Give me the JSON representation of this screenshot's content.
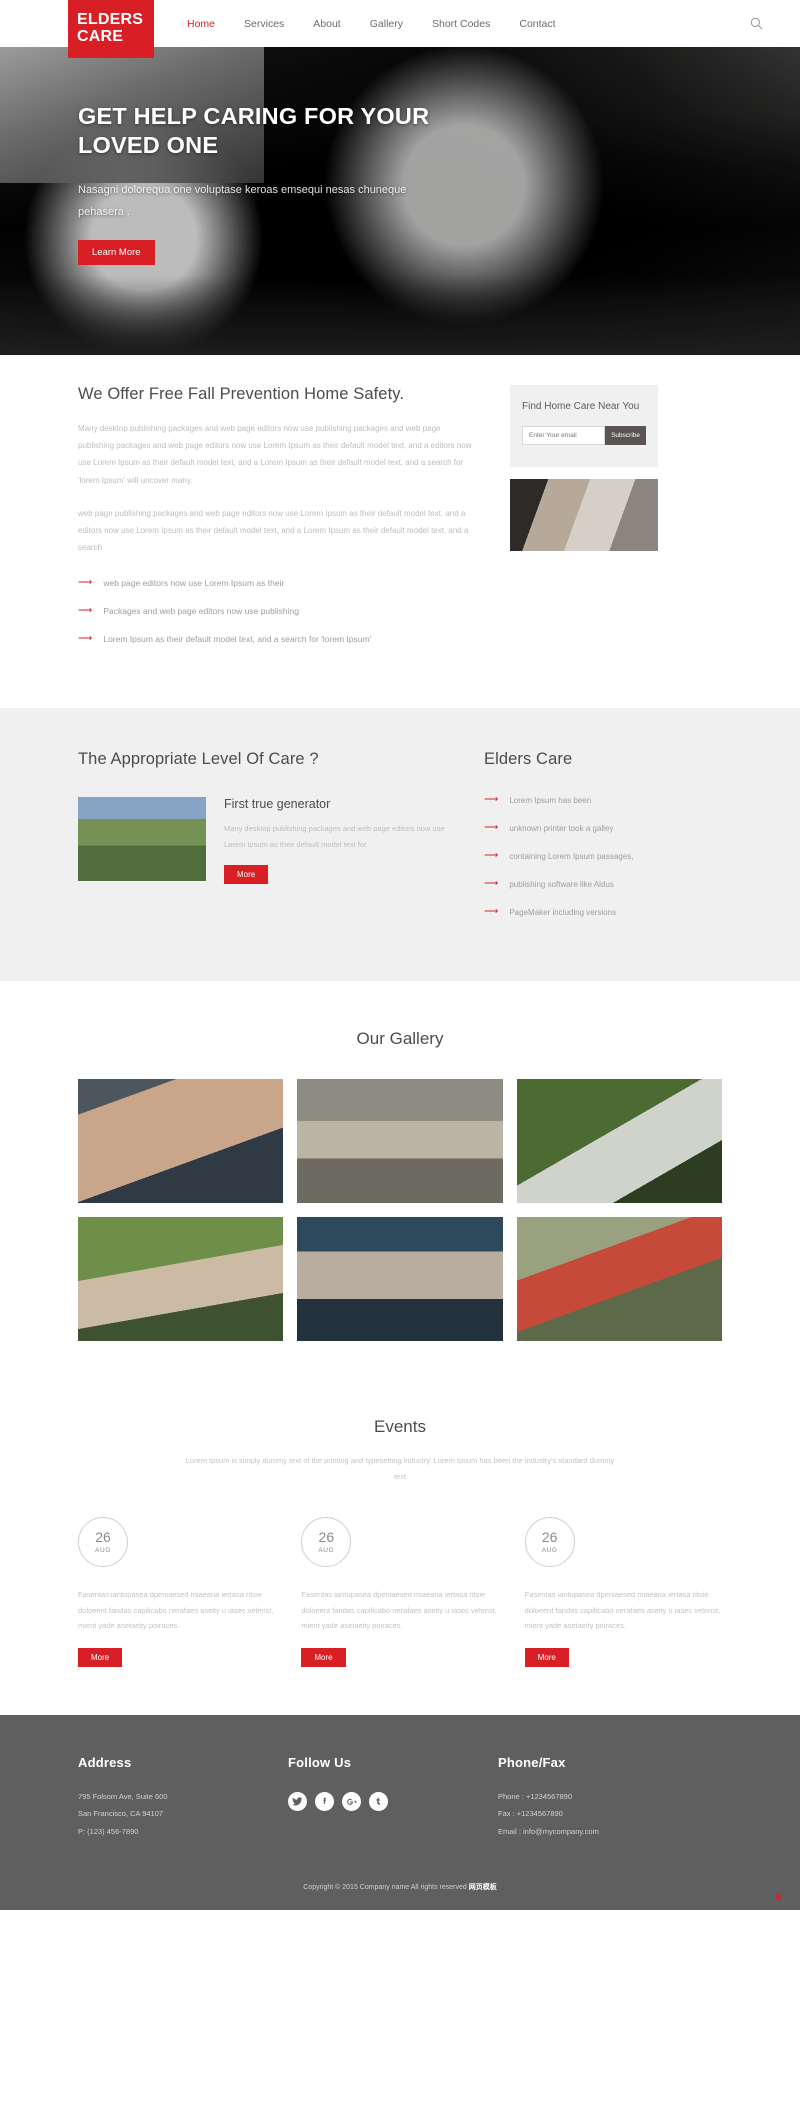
{
  "brand": {
    "line1": "ELDERS",
    "line2": "CARE",
    "color": "#d81f26"
  },
  "nav": {
    "items": [
      {
        "label": "Home",
        "active": true
      },
      {
        "label": "Services",
        "active": false
      },
      {
        "label": "About",
        "active": false
      },
      {
        "label": "Gallery",
        "active": false
      },
      {
        "label": "Short Codes",
        "active": false
      },
      {
        "label": "Contact",
        "active": false
      }
    ],
    "search_icon": "search-icon"
  },
  "hero": {
    "title": "GET HELP CARING FOR YOUR LOVED ONE",
    "subtitle": "Nasagni dolorequa one voluptase keroas emsequi nesas chuneque pehasera .",
    "button": "Learn More"
  },
  "offer": {
    "heading": "We Offer Free Fall Prevention Home Safety.",
    "paragraph1": "Many desktop publishing packages and web page editors now use publishing packages and web page publishing packages and web page editors now use Lorem Ipsum as their default model text, and a editors now use Lorem Ipsum as their default model text, and a Lorem Ipsum as their default model text, and a search for 'lorem Ipsum' will uncover many.",
    "paragraph2": "web page publishing packages and web page editors now use Lorem Ipsum as their default model text, and a editors now use Lorem Ipsum as their default model text, and a Lorem Ipsum as their default model text, and a search",
    "bullets": [
      "web page editors now use Lorem Ipsum as their",
      "Packages and web page editors now use publishing",
      "Lorem Ipsum as their default model text, and a search for 'lorem Ipsum'"
    ],
    "sidebar": {
      "title": "Find Home Care Near You",
      "input_placeholder": "Enter Your email",
      "input_value": "",
      "button": "Subscribe",
      "photo_name": "two-women-photo"
    }
  },
  "care": {
    "heading": "The Appropriate Level Of Care ?",
    "card": {
      "image_name": "elderly-couple-outdoors-photo",
      "title": "First true generator",
      "text": "Many desktop publishing packages and web page editors now use Lorem Ipsum as their default model text for",
      "button": "More"
    },
    "right_heading": "Elders Care",
    "bullets": [
      "Lorem Ipsum has been",
      "unknown printer took a galley",
      "containing Lorem Ipsum passages,",
      "publishing software like Aldus",
      "PageMaker including versions"
    ]
  },
  "gallery": {
    "heading": "Our Gallery",
    "items": [
      {
        "name": "gallery-photo-elderly-man"
      },
      {
        "name": "gallery-photo-couple-walking"
      },
      {
        "name": "gallery-photo-woman-garden"
      },
      {
        "name": "gallery-photo-woman-sunglasses"
      },
      {
        "name": "gallery-photo-woman-portrait"
      },
      {
        "name": "gallery-photo-couple-backyard"
      }
    ]
  },
  "events": {
    "heading": "Events",
    "subtitle": "Lorem Ipsum is simply dummy text of the printing and typesetting industry. Lorem Ipsum has been the industry's standard dummy text",
    "items": [
      {
        "day": "26",
        "month": "AUG",
        "text": "Fasentas iantupasea dpeniaesed miaeana iertasa ritsie doloeent fandas capilicabo nerafaes aseity u iasec velenst, mient yade asetaeity poiraces.",
        "button": "More"
      },
      {
        "day": "26",
        "month": "AUG",
        "text": "Fasentas iantupasea dpeniaesed miaeana iertasa ritsie doloeent fandas capilicabo nerafaes aseity u iasec velenst, mient yade asetaeity poiraces.",
        "button": "More"
      },
      {
        "day": "26",
        "month": "AUG",
        "text": "Fasentas iantupasea dpeniaesed miaeana iertasa ritsie doloeent fandas capilicabo nerafaes aseity u iasec velenst, mient yade asetaeity poiraces.",
        "button": "More"
      }
    ]
  },
  "footer": {
    "address": {
      "heading": "Address",
      "line1": "795 Folsom Ave, Suite 600",
      "line2": "San Francisco, CA 94107",
      "line3": "P: (123) 456-7890"
    },
    "follow": {
      "heading": "Follow Us",
      "socials": [
        {
          "name": "twitter-icon",
          "glyph": "✉"
        },
        {
          "name": "facebook-icon",
          "glyph": "f"
        },
        {
          "name": "google-plus-icon",
          "glyph": "g+"
        },
        {
          "name": "tumblr-icon",
          "glyph": "t"
        }
      ]
    },
    "phone": {
      "heading": "Phone/Fax",
      "line1": "Phone : +1234567890",
      "line2": "Fax : +1234567890",
      "line3": "Email : info@mycompany.com"
    },
    "copyright_prefix": "Copyright © 2015 Company name All rights reserved ",
    "copyright_link": "网页模板",
    "to_top_icon": "scroll-to-top-icon"
  }
}
